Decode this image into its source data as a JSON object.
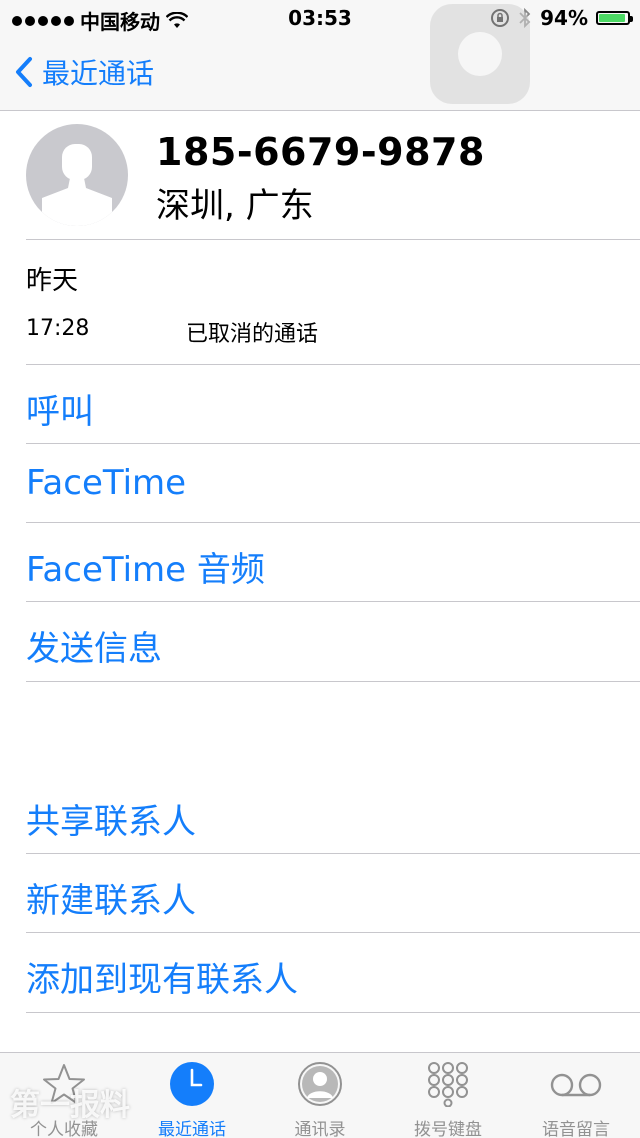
{
  "status_bar": {
    "carrier": "中国移动",
    "time": "03:53",
    "battery_percent": "94%",
    "battery_level": 0.94,
    "battery_color": "#4cd964"
  },
  "nav": {
    "back_label": "最近通话"
  },
  "contact": {
    "phone_number": "185-6679-9878",
    "location": "深圳, 广东"
  },
  "call_log": {
    "day": "昨天",
    "time": "17:28",
    "status": "已取消的通话"
  },
  "actions": {
    "call": "呼叫",
    "facetime": "FaceTime",
    "facetime_audio": "FaceTime 音频",
    "send_message": "发送信息",
    "share_contact": "共享联系人",
    "new_contact": "新建联系人",
    "add_to_existing": "添加到现有联系人"
  },
  "tab_bar": {
    "tabs": [
      {
        "label": "个人收藏",
        "icon": "star-icon",
        "active": false
      },
      {
        "label": "最近通话",
        "icon": "clock-icon",
        "active": true
      },
      {
        "label": "通讯录",
        "icon": "contacts-icon",
        "active": false
      },
      {
        "label": "拨号键盘",
        "icon": "keypad-icon",
        "active": false
      },
      {
        "label": "语音留言",
        "icon": "voicemail-icon",
        "active": false
      }
    ]
  },
  "watermark": "第一报料",
  "accent_color": "#147efb"
}
